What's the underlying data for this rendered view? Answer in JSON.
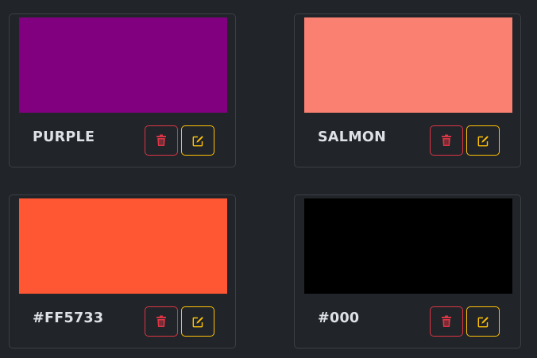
{
  "cards": [
    {
      "name": "PURPLE",
      "color": "#800080"
    },
    {
      "name": "SALMON",
      "color": "#FA8072"
    },
    {
      "name": "#FF5733",
      "color": "#FF5733"
    },
    {
      "name": "#000",
      "color": "#000000"
    }
  ],
  "icons": {
    "delete": "trash-icon",
    "edit": "pencil-square-icon"
  },
  "colors": {
    "background": "#212529",
    "card_border": "#3b4046",
    "text": "#dee2e6",
    "danger": "#dc3545",
    "warning": "#ffc107"
  }
}
